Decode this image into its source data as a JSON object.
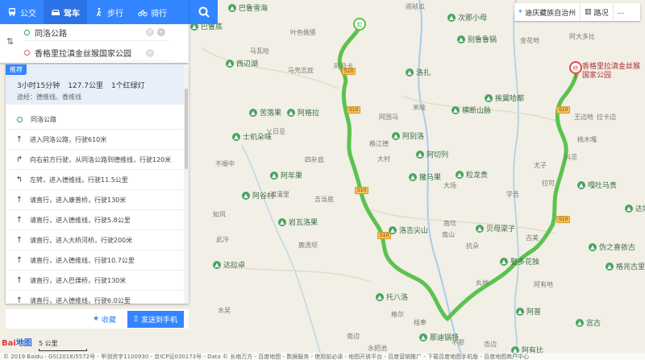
{
  "modes": [
    {
      "icon": "bus-icon",
      "label": "公交",
      "active": false
    },
    {
      "icon": "car-icon",
      "label": "驾车",
      "active": true
    },
    {
      "icon": "walk-icon",
      "label": "步行",
      "active": false
    },
    {
      "icon": "bike-icon",
      "label": "骑行",
      "active": false
    }
  ],
  "route": {
    "start": "同洛公路",
    "end": "香格里拉滇金丝猴国家公园"
  },
  "summary": {
    "tag": "推荐",
    "duration": "3小时15分钟",
    "distance": "127.7公里",
    "lights": "1个红绿灯",
    "via": "途经：德维线、香维线"
  },
  "steps": [
    {
      "icon": "start",
      "text": "同洛公路"
    },
    {
      "icon": "straight",
      "text": "进入同洛公路，行驶610米"
    },
    {
      "icon": "right",
      "text": "向右前方行驶，从同洛公路到德维线，行驶120米"
    },
    {
      "icon": "left",
      "text": "左转，进入德维线，行驶11.5公里"
    },
    {
      "icon": "straight",
      "text": "请直行，进入康普桥，行驶130米"
    },
    {
      "icon": "straight",
      "text": "请直行，进入德维线，行驶5.8公里"
    },
    {
      "icon": "straight",
      "text": "请直行，进入大桥河桥，行驶200米"
    },
    {
      "icon": "straight",
      "text": "请直行，进入德维线，行驶10.7公里"
    },
    {
      "icon": "straight",
      "text": "请直行，进入巴傈桥，行驶130米"
    },
    {
      "icon": "straight",
      "text": "请直行，进入德维线，行驶6.0公里"
    }
  ],
  "actions": {
    "collect": "收藏",
    "send": "发送到手机"
  },
  "topbar": {
    "city": "迪庆藏族自治州",
    "roads": "路况",
    "more": "..."
  },
  "map": {
    "route_shields": [
      "S10",
      "S10",
      "S10",
      "S10",
      "S10",
      "S10"
    ],
    "start_marker": "起",
    "end_marker": "终",
    "end_label": "香格里拉滇金丝猴国家公园",
    "poi_labels": [
      "巴鲁雪海",
      "巴鲁底",
      "西辺湖",
      "苦落果",
      "阿格拉",
      "士机朵味",
      "阿年果",
      "岩瓦洛果",
      "达拉卓",
      "托八洛",
      "洛扎",
      "阿别洛",
      "阿切列",
      "撒马果",
      "粒龙贵",
      "洛吉尖山",
      "贝母梁子",
      "娶多花独",
      "阿普",
      "宫古",
      "那迪锅特",
      "阿有比",
      "次那小母",
      "别鲁鲁锅",
      "挨翼哈都",
      "横断山脉",
      "嘎吐马贵",
      "达境",
      "伪之喜依古",
      "格兆古里",
      "阿谷村"
    ],
    "place_labels": [
      "闹祯瓜",
      "叶色俄堡",
      "马壳志底",
      "阿月卡",
      "马瓦哈",
      "米哇",
      "阿国马",
      "南坎",
      "大村",
      "四补底",
      "格江德",
      "乂日旦",
      "不顺中",
      "渡灌里",
      "吉当底",
      "大场",
      "学吾",
      "南山",
      "抗朵",
      "古美",
      "尤子",
      "拉可",
      "科灵",
      "桃木嘎",
      "阿大多比",
      "知风",
      "鹿洗坝",
      "此冷",
      "拉卡边",
      "王边地",
      "水吴",
      "阿有地",
      "丸地",
      "南边",
      "格尔",
      "桂奉",
      "不那",
      "杏边",
      "水把池",
      "金花地"
    ],
    "scale_label": "5 公里"
  },
  "footer": {
    "logo_main": "Bai",
    "logo_suffix": "地图",
    "copyright": "© 2019 Baidu - GS(2018)5572号 - 甲测资字1100930 - 京ICP证030173号 - Data © 长地万方 - 百度地图 - 数据服务 - 使用前必读 - 地图开放平台 - 百度营销推广 - 下载百度地图手机版 - 百度地图商户中心"
  },
  "colors": {
    "accent": "#3385ff",
    "route": "#5cc24f",
    "map_bg": "#f1efe6"
  }
}
